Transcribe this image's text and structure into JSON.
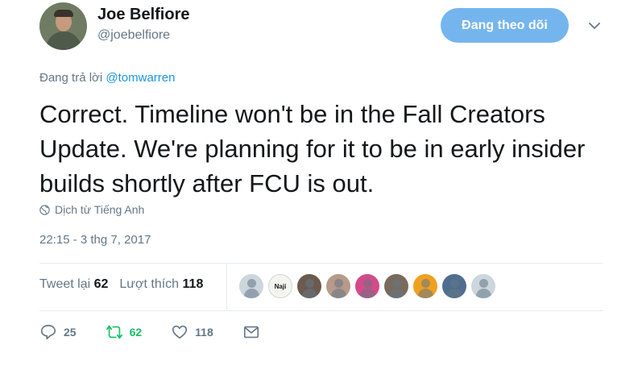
{
  "user": {
    "display_name": "Joe Belfiore",
    "handle": "@joebelfiore"
  },
  "follow_button_label": "Đang theo dõi",
  "reply": {
    "prefix": "Đang trả lời",
    "mention": "@tomwarren"
  },
  "tweet_text": "Correct.  Timeline won't be in the Fall Creators Update. We're planning for it to be in early insider builds shortly after FCU is out.",
  "translate_label": "Dịch từ Tiếng Anh",
  "timestamp": "22:15 - 3 thg 7, 2017",
  "stats": {
    "retweets_label": "Tweet lại",
    "retweets_count": "62",
    "likes_label": "Lượt thích",
    "likes_count": "118"
  },
  "likers": [
    {
      "label": "",
      "color": "#ccd6dd"
    },
    {
      "label": "Naji",
      "color": "#f5f5f0"
    },
    {
      "label": "",
      "color": "#6b5a4e"
    },
    {
      "label": "",
      "color": "#b89a8a"
    },
    {
      "label": "",
      "color": "#d34b88"
    },
    {
      "label": "",
      "color": "#7a6a5e"
    },
    {
      "label": "",
      "color": "#f0a020"
    },
    {
      "label": "",
      "color": "#4f6d8f"
    },
    {
      "label": "",
      "color": "#ccd6dd"
    }
  ],
  "actions": {
    "replies": "25",
    "retweets": "62",
    "likes": "118"
  },
  "colors": {
    "accent": "#1b95e0",
    "follow_bg": "#75b5ee",
    "retweet": "#17bf63",
    "muted": "#657786"
  }
}
